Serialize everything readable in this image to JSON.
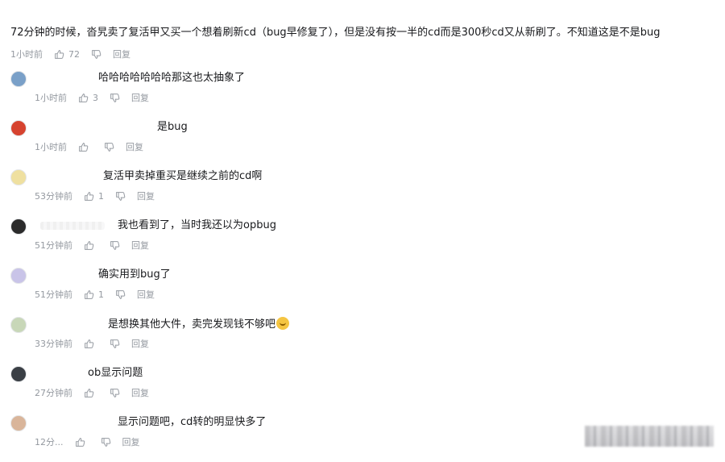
{
  "main_comment": {
    "text": "72分钟的时候，沓旯卖了复活甲又买一个想着刷新cd（bug早修复了），但是没有按一半的cd而是300秒cd又从新刷了。不知道这是不是bug",
    "time": "1小时前",
    "likes": "72",
    "reply_label": "回复"
  },
  "replies": [
    {
      "text": "哈哈哈哈哈哈哈那这也太抽象了",
      "time": "1小时前",
      "likes": "3",
      "reply_label": "回复",
      "avatar_color": "#7aa0c8"
    },
    {
      "text": "是bug",
      "time": "1小时前",
      "likes": "",
      "reply_label": "回复",
      "avatar_color": "#d6432f"
    },
    {
      "text": "复活甲卖掉重买是继续之前的cd啊",
      "time": "53分钟前",
      "likes": "1",
      "reply_label": "回复",
      "avatar_color": "#efe0a0"
    },
    {
      "text": "我也看到了，当时我还以为opbug",
      "time": "51分钟前",
      "likes": "",
      "reply_label": "回复",
      "avatar_color": "#2b2b2b"
    },
    {
      "text": "确实用到bug了",
      "time": "51分钟前",
      "likes": "1",
      "reply_label": "回复",
      "avatar_color": "#c9c4e8"
    },
    {
      "text": "是想换其他大件，卖完发现钱不够吧",
      "time": "33分钟前",
      "likes": "",
      "reply_label": "回复",
      "avatar_color": "#c8d7b8"
    },
    {
      "text": "ob显示问题",
      "time": "27分钟前",
      "likes": "",
      "reply_label": "回复",
      "avatar_color": "#3a3f45"
    },
    {
      "text": "显示问题吧，cd转的明显快多了",
      "time": "12分...",
      "likes": "",
      "reply_label": "回复",
      "avatar_color": "#d9b59a"
    }
  ],
  "icons": {
    "like": "thumbs-up-icon",
    "dislike": "thumbs-down-icon",
    "emoji": "sweat-smile-emoji-icon"
  }
}
